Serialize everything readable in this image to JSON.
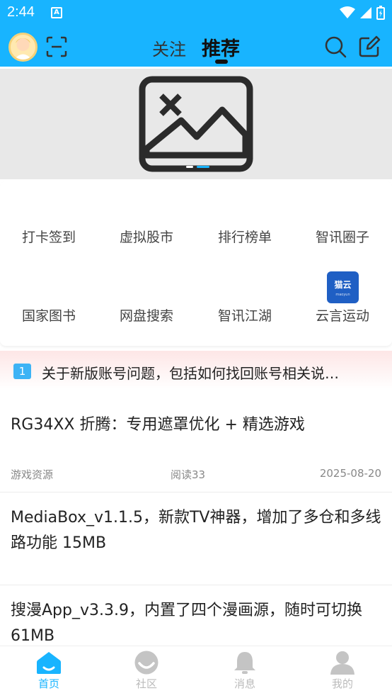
{
  "status_bar": {
    "time": "2:44",
    "notification_glyph": "A"
  },
  "header": {
    "tabs": [
      {
        "label": "关注",
        "active": false
      },
      {
        "label": "推荐",
        "active": true
      }
    ],
    "icons": [
      "avatar",
      "scan-icon",
      "search-icon",
      "edit-icon"
    ]
  },
  "banner": {
    "image_icon": "broken-image-icon",
    "page_count": 2,
    "active_page": 2
  },
  "shortcuts": [
    {
      "label": "打卡签到"
    },
    {
      "label": "虚拟股市"
    },
    {
      "label": "排行榜单"
    },
    {
      "label": "智讯圈子"
    },
    {
      "label": "国家图书"
    },
    {
      "label": "网盘搜索"
    },
    {
      "label": "智讯江湖"
    },
    {
      "label": "云言运动",
      "logo_text": "猫云"
    }
  ],
  "notice": {
    "badge": "1",
    "text": "关于新版账号问题，包括如何找回账号相关说…"
  },
  "posts": [
    {
      "title": "RG34XX 折腾：专用遮罩优化 + 精选游戏",
      "category": "游戏资源",
      "reads": "阅读33",
      "date": "2025-08-20"
    },
    {
      "title": "MediaBox_v1.1.5，新款TV神器，增加了多仓和多线路功能 15MB"
    },
    {
      "title": "搜漫App_v3.3.9，内置了四个漫画源，随时可切换61MB"
    }
  ],
  "bottom_nav": [
    {
      "label": "首页",
      "icon": "home-icon",
      "active": true
    },
    {
      "label": "社区",
      "icon": "community-icon",
      "active": false
    },
    {
      "label": "消息",
      "icon": "bell-icon",
      "active": false
    },
    {
      "label": "我的",
      "icon": "profile-icon",
      "active": false
    }
  ],
  "colors": {
    "accent": "#18b4ff",
    "inactive": "#bbbbbb",
    "notice_badge": "#3db3f5",
    "logo": "#1f5fc4"
  }
}
